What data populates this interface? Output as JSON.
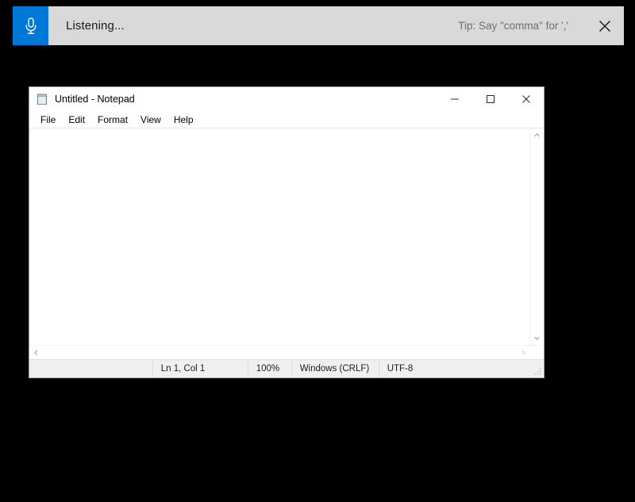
{
  "voice_bar": {
    "mic_icon": "microphone-icon",
    "status_text": "Listening...",
    "tip_text": "Tip: Say \"comma\" for ','",
    "close_icon": "close-icon",
    "accent_color": "#0078d7",
    "background_color": "#d9d9d9"
  },
  "notepad": {
    "icon": "notepad-icon",
    "title": "Untitled - Notepad",
    "controls": {
      "minimize_label": "Minimize",
      "maximize_label": "Maximize",
      "close_label": "Close",
      "minimize_icon": "minimize-icon",
      "maximize_icon": "maximize-icon",
      "close_icon": "close-icon"
    },
    "menu": [
      {
        "label": "File"
      },
      {
        "label": "Edit"
      },
      {
        "label": "Format"
      },
      {
        "label": "View"
      },
      {
        "label": "Help"
      }
    ],
    "document": {
      "text": "",
      "placeholder": ""
    },
    "scrollbars": {
      "up_icon": "chevron-up-icon",
      "down_icon": "chevron-down-icon",
      "left_icon": "chevron-left-icon",
      "right_icon": "chevron-right-icon"
    },
    "statusbar": {
      "cursor_position": "Ln 1, Col 1",
      "zoom": "100%",
      "line_ending": "Windows (CRLF)",
      "encoding": "UTF-8",
      "grip_icon": "resize-grip-icon"
    }
  },
  "desktop": {
    "background_color": "#000000"
  }
}
